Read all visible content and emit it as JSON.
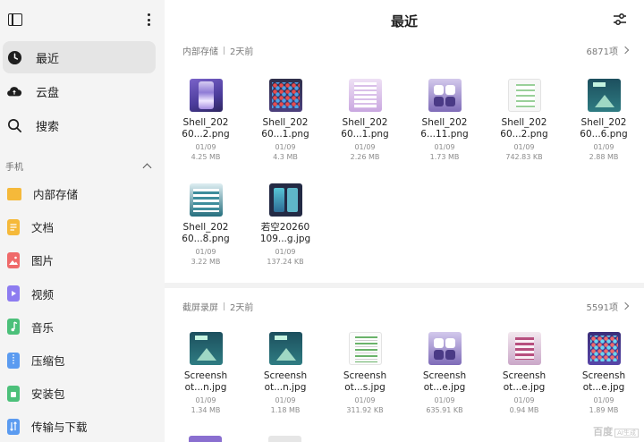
{
  "sidebar": {
    "nav": [
      {
        "label": "最近",
        "icon": "clock-icon",
        "active": true
      },
      {
        "label": "云盘",
        "icon": "cloud-icon",
        "active": false
      },
      {
        "label": "搜索",
        "icon": "search-icon",
        "active": false
      }
    ],
    "section_title": "手机",
    "categories": [
      {
        "label": "内部存储",
        "icon": "folder-icon",
        "color": "#f5b93a"
      },
      {
        "label": "文档",
        "icon": "document-icon",
        "color": "#f5b93a"
      },
      {
        "label": "图片",
        "icon": "image-icon",
        "color": "#ef6a6a"
      },
      {
        "label": "视频",
        "icon": "video-icon",
        "color": "#8d7cf0"
      },
      {
        "label": "音乐",
        "icon": "music-icon",
        "color": "#4cc07a"
      },
      {
        "label": "压缩包",
        "icon": "archive-icon",
        "color": "#5b9bf0"
      },
      {
        "label": "安装包",
        "icon": "apk-icon",
        "color": "#4cc07a"
      },
      {
        "label": "传输与下载",
        "icon": "transfer-icon",
        "color": "#5b9bf0"
      }
    ]
  },
  "main": {
    "title": "最近",
    "groups": [
      {
        "source": "内部存储",
        "time": "2天前",
        "count": "6871项",
        "files": [
          {
            "name1": "Shell_202",
            "name2": "60...2.png",
            "date": "01/09",
            "size": "4.25 MB",
            "thumb": "th-purple"
          },
          {
            "name1": "Shell_202",
            "name2": "60...1.png",
            "date": "01/09",
            "size": "4.3 MB",
            "thumb": "th-dark"
          },
          {
            "name1": "Shell_202",
            "name2": "60...1.png",
            "date": "01/09",
            "size": "2.26 MB",
            "thumb": "th-pink"
          },
          {
            "name1": "Shell_202",
            "name2": "6...11.png",
            "date": "01/09",
            "size": "1.73 MB",
            "thumb": "th-ctrl"
          },
          {
            "name1": "Shell_202",
            "name2": "60...2.png",
            "date": "01/09",
            "size": "742.83 KB",
            "thumb": "th-white"
          },
          {
            "name1": "Shell_202",
            "name2": "60...6.png",
            "date": "01/09",
            "size": "2.88 MB",
            "thumb": "th-teal"
          },
          {
            "name1": "Shell_202",
            "name2": "60...8.png",
            "date": "01/09",
            "size": "3.22 MB",
            "thumb": "th-teal2"
          },
          {
            "name1": "若空20260",
            "name2": "109...g.jpg",
            "date": "01/09",
            "size": "137.24 KB",
            "thumb": "th-twophone"
          }
        ]
      },
      {
        "source": "截屏录屏",
        "time": "2天前",
        "count": "5591项",
        "files": [
          {
            "name1": "Screensh",
            "name2": "ot...n.jpg",
            "date": "01/09",
            "size": "1.34 MB",
            "thumb": "th-teal"
          },
          {
            "name1": "Screensh",
            "name2": "ot...n.jpg",
            "date": "01/09",
            "size": "1.18 MB",
            "thumb": "th-teal"
          },
          {
            "name1": "Screensh",
            "name2": "ot...s.jpg",
            "date": "01/09",
            "size": "311.92 KB",
            "thumb": "th-list"
          },
          {
            "name1": "Screensh",
            "name2": "ot...e.jpg",
            "date": "01/09",
            "size": "635.91 KB",
            "thumb": "th-ctrl"
          },
          {
            "name1": "Screensh",
            "name2": "ot...e.jpg",
            "date": "01/09",
            "size": "0.94 MB",
            "thumb": "th-pinkctrl"
          },
          {
            "name1": "Screensh",
            "name2": "ot...e.jpg",
            "date": "01/09",
            "size": "1.89 MB",
            "thumb": "th-icons"
          }
        ]
      }
    ]
  },
  "watermark": {
    "text": "百度",
    "badge": "AI生成"
  }
}
